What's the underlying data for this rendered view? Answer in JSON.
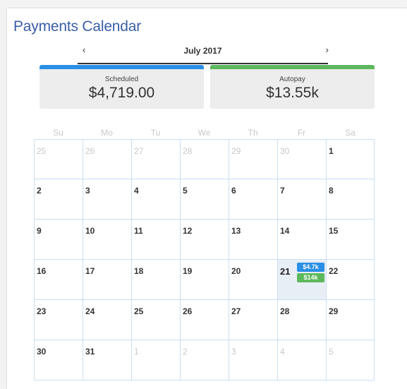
{
  "title": "Payments Calendar",
  "nav": {
    "prev": "‹",
    "next": "›",
    "month": "July 2017"
  },
  "summary": {
    "scheduled": {
      "label": "Scheduled",
      "value": "$4,719.00",
      "color": "#2a8fe6"
    },
    "autopay": {
      "label": "Autopay",
      "value": "$13.55k",
      "color": "#5cb85c"
    }
  },
  "weekdays": [
    "Su",
    "Mo",
    "Tu",
    "We",
    "Th",
    "Fr",
    "Sa"
  ],
  "weeks": [
    [
      {
        "d": "25",
        "o": true
      },
      {
        "d": "26",
        "o": true
      },
      {
        "d": "27",
        "o": true
      },
      {
        "d": "28",
        "o": true
      },
      {
        "d": "29",
        "o": true
      },
      {
        "d": "30",
        "o": true
      },
      {
        "d": "1"
      }
    ],
    [
      {
        "d": "2"
      },
      {
        "d": "3"
      },
      {
        "d": "4"
      },
      {
        "d": "5"
      },
      {
        "d": "6"
      },
      {
        "d": "7"
      },
      {
        "d": "8"
      }
    ],
    [
      {
        "d": "9"
      },
      {
        "d": "10"
      },
      {
        "d": "11"
      },
      {
        "d": "12"
      },
      {
        "d": "13"
      },
      {
        "d": "14"
      },
      {
        "d": "15"
      }
    ],
    [
      {
        "d": "16"
      },
      {
        "d": "17"
      },
      {
        "d": "18"
      },
      {
        "d": "19"
      },
      {
        "d": "20"
      },
      {
        "d": "21",
        "today": true,
        "pills": [
          {
            "text": "$4.7k",
            "color": "#2a8fe6"
          },
          {
            "text": "$14k",
            "color": "#5cb85c"
          }
        ]
      },
      {
        "d": "22"
      }
    ],
    [
      {
        "d": "23"
      },
      {
        "d": "24"
      },
      {
        "d": "25"
      },
      {
        "d": "26"
      },
      {
        "d": "27"
      },
      {
        "d": "28"
      },
      {
        "d": "29"
      }
    ],
    [
      {
        "d": "30"
      },
      {
        "d": "31"
      },
      {
        "d": "1",
        "o": true
      },
      {
        "d": "2",
        "o": true
      },
      {
        "d": "3",
        "o": true
      },
      {
        "d": "4",
        "o": true
      },
      {
        "d": "5",
        "o": true
      }
    ]
  ]
}
